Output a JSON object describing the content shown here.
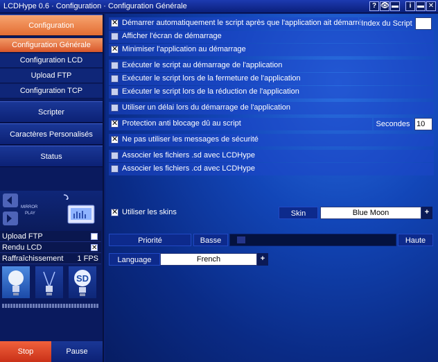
{
  "window": {
    "title": "LCDHype 0.6 · Configuration · Configuration Générale"
  },
  "titlebar_buttons": [
    "?",
    "👁",
    "▬",
    "i",
    "▬",
    "✕"
  ],
  "sidebar": {
    "main_items": [
      {
        "label": "Configuration",
        "active": true
      },
      {
        "label": "Scripter",
        "active": false
      },
      {
        "label": "Caractères Personalisés",
        "active": false
      },
      {
        "label": "Status",
        "active": false
      }
    ],
    "sub_items": [
      {
        "label": "Configuration Générale",
        "active": true
      },
      {
        "label": "Configuration LCD",
        "active": false
      },
      {
        "label": "Upload FTP",
        "active": false
      },
      {
        "label": "Configuration TCP",
        "active": false
      }
    ],
    "mirror_label": "MIRROR\nPLAY",
    "status": {
      "upload_ftp": {
        "label": "Upload FTP",
        "checked": false
      },
      "rendu_lcd": {
        "label": "Rendu LCD",
        "checked": true
      },
      "refresh": {
        "label": "Raffraîchissement",
        "value": "1 FPS"
      }
    },
    "bulb_labels": [
      "",
      "",
      "SD"
    ],
    "stop_label": "Stop",
    "pause_label": "Pause"
  },
  "main": {
    "options": [
      {
        "label": "Démarrer automatiquement le script après que l'application ait démarré",
        "checked": true
      },
      {
        "label": "Afficher l'écran de démarrage",
        "checked": false
      },
      {
        "label": "Minimiser l'application au démarrage",
        "checked": true
      },
      {
        "label": "Exécuter le script au démarrage de l'application",
        "checked": false
      },
      {
        "label": "Exécuter le script lors de la fermeture de l'application",
        "checked": false
      },
      {
        "label": "Exécuter le script lors de la réduction de l'application",
        "checked": false
      },
      {
        "label": "Utiliser un délai lors du démarrage de l'application",
        "checked": false
      },
      {
        "label": "Protection anti blocage dû au script",
        "checked": true
      },
      {
        "label": "Ne pas utiliser les messages de sécurité",
        "checked": true
      },
      {
        "label": "Associer les fichiers .sd avec LCDHype",
        "checked": false
      },
      {
        "label": "Associer les fichiers .cd avec LCDHype",
        "checked": false
      }
    ],
    "script_index": {
      "label": "Index du Script",
      "value": ""
    },
    "seconds": {
      "label": "Secondes",
      "value": "10"
    },
    "skins": {
      "label": "Utiliser les skins",
      "checked": true,
      "skin_label": "Skin",
      "skin_value": "Blue Moon"
    },
    "priority": {
      "label": "Priorité",
      "low": "Basse",
      "high": "Haute",
      "level": 0.05
    },
    "language": {
      "label": "Language",
      "value": "French"
    }
  },
  "colors": {
    "accent": "#e8773f",
    "panel": "#0a1a5e"
  }
}
